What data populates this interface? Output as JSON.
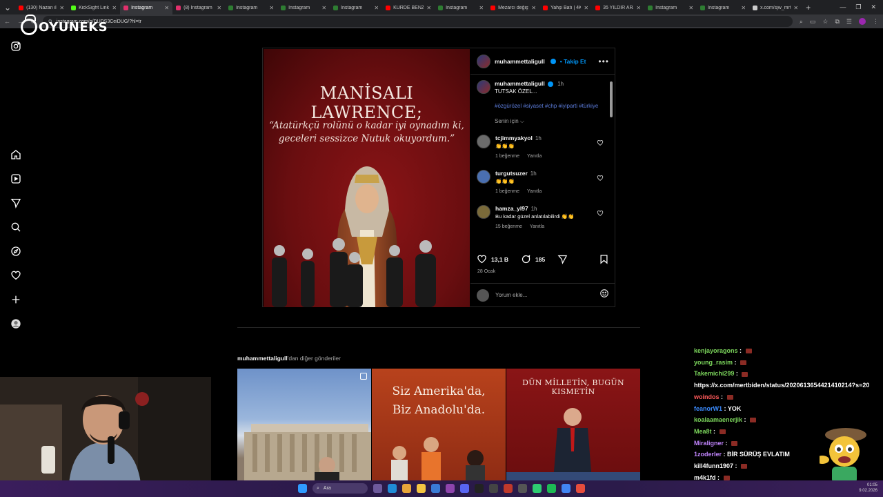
{
  "browser": {
    "tabs": [
      {
        "label": "(130) Nazan ile",
        "color": "#ff0000",
        "active": false
      },
      {
        "label": "KickSight Link",
        "color": "#53fc18",
        "active": false
      },
      {
        "label": "Instagram",
        "color": "#e1306c",
        "active": true
      },
      {
        "label": "(8) Instagram",
        "color": "#e1306c",
        "active": false
      },
      {
        "label": "Instagram",
        "color": "#2e7d32",
        "active": false
      },
      {
        "label": "Instagram",
        "color": "#2e7d32",
        "active": false
      },
      {
        "label": "Instagram",
        "color": "#2e7d32",
        "active": false
      },
      {
        "label": "KÜRDE BENZİY",
        "color": "#ff0000",
        "active": false
      },
      {
        "label": "Instagram",
        "color": "#2e7d32",
        "active": false
      },
      {
        "label": "Mezarcı değişy",
        "color": "#ff0000",
        "active": false
      },
      {
        "label": "Yahşi Batı | 4K",
        "color": "#ff0000",
        "active": false
      },
      {
        "label": "35 YILDIR ARA",
        "color": "#ff0000",
        "active": false
      },
      {
        "label": "Instagram",
        "color": "#2e7d32",
        "active": false
      },
      {
        "label": "Instagram",
        "color": "#2e7d32",
        "active": false
      },
      {
        "label": "x.com/sjw_mrt",
        "color": "#cccccc",
        "active": false
      }
    ],
    "url": "instagram.com/p/DUDS3CeiDUG/?hl=tr"
  },
  "overlay": {
    "logo_text": "OYUNEKS"
  },
  "post": {
    "image": {
      "title": "MANİSALI LAWRENCE;",
      "quote": "“Atatürkçü rolünü o kadar iyi oynadım ki, geceleri sessizce Nutuk okuyordum.”"
    },
    "author": "muhammettaligull",
    "follow_label": "• Takip Et",
    "more_label": "•••",
    "caption_user": "muhammettaligull",
    "caption_time": "1h",
    "caption_text": "TUTSAK ÖZEL...",
    "hashtags": "#özgürözel #siyaset #chp #iyiparti #türkiye",
    "for_you": "Senin için ⌵",
    "comments": [
      {
        "user": "tcjimmyakyol",
        "time": "1h",
        "text": "👏👏👏",
        "likes": "1 beğenme",
        "reply": "Yanıtla"
      },
      {
        "user": "turgutsuzer",
        "time": "1h",
        "text": "👏👏👏",
        "likes": "1 beğenme",
        "reply": "Yanıtla"
      },
      {
        "user": "hamza_yl97",
        "time": "1h",
        "text": "Bu kadar güzel anlatılabilirdi 👏👏",
        "likes": "15 beğenme",
        "reply": "Yanıtla"
      }
    ],
    "like_count": "13,1 B",
    "comment_count": "185",
    "date": "28 Ocak",
    "comment_placeholder": "Yorum ekle..."
  },
  "more_posts": {
    "user": "muhammettaligull",
    "suffix": "'dan diğer gönderiler",
    "cells": [
      {
        "text": ""
      },
      {
        "text": "Siz Amerika'da, Biz Anadolu'da."
      },
      {
        "text": "DÜN MİLLETİN, BUGÜN KISMETİN"
      }
    ]
  },
  "chat": [
    {
      "user": "kenjayoragons",
      "color": "#7cd65c",
      "msg": ""
    },
    {
      "user": "young_rasim",
      "color": "#7cd65c",
      "msg": ""
    },
    {
      "user": "Takemichi299",
      "color": "#7cd65c",
      "msg": ""
    },
    {
      "user": "",
      "color": "#ffffff",
      "msg": "https://x.com/mertbiden/status/2020613654421410214?s=20"
    },
    {
      "user": "woindos",
      "color": "#ff5a5a",
      "msg": ""
    },
    {
      "user": "feanorW1",
      "color": "#3c8cff",
      "msg": "YOK"
    },
    {
      "user": "koalaamaenerjik",
      "color": "#7cd65c",
      "msg": ""
    },
    {
      "user": "Mea8t",
      "color": "#7cd65c",
      "msg": ""
    },
    {
      "user": "Miraligner",
      "color": "#c084fc",
      "msg": ""
    },
    {
      "user": "1zoderler",
      "color": "#c084fc",
      "msg": "BİR SÜRÜŞ EVLATIM"
    },
    {
      "user": "kill4funn1907",
      "color": "#ffffff",
      "msg": ""
    },
    {
      "user": "m4k1fd",
      "color": "#ffffff",
      "msg": ""
    }
  ],
  "taskbar": {
    "search_placeholder": "Ara",
    "time": "01:05",
    "date": "9.02.2026"
  }
}
